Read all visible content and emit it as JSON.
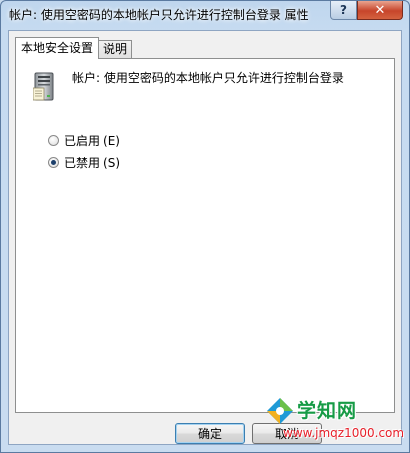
{
  "window": {
    "title": "帐户: 使用空密码的本地帐户只允许进行控制台登录 属性",
    "help_symbol": "?",
    "close_symbol": "✕"
  },
  "tabs": [
    {
      "label": "本地安全设置",
      "active": true
    },
    {
      "label": "说明",
      "active": false
    }
  ],
  "policy": {
    "icon": "server-computer-icon",
    "name": "帐户: 使用空密码的本地帐户只允许进行控制台登录"
  },
  "options": [
    {
      "label": "已启用",
      "accel": "(E)",
      "checked": false
    },
    {
      "label": "已禁用",
      "accel": "(S)",
      "checked": true
    }
  ],
  "buttons": {
    "ok": "确定",
    "cancel": "取消"
  },
  "watermark": {
    "title": "学知网",
    "url": "www.jmqz1000.com"
  }
}
